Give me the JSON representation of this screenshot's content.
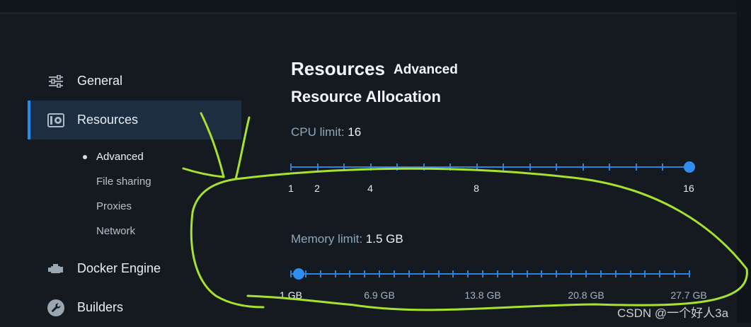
{
  "sidebar": {
    "items": [
      {
        "label": "General",
        "icon": "sliders-icon"
      },
      {
        "label": "Resources",
        "icon": "resources-icon",
        "active": true
      },
      {
        "label": "Docker Engine",
        "icon": "engine-icon"
      },
      {
        "label": "Builders",
        "icon": "wrench-icon"
      }
    ],
    "sub_items": [
      "Advanced",
      "File sharing",
      "Proxies",
      "Network"
    ]
  },
  "main": {
    "title": "Resources",
    "tab": "Advanced",
    "subtitle": "Resource Allocation",
    "cpu": {
      "label": "CPU limit:",
      "value": "16",
      "tick_labels": [
        "1",
        "2",
        "4",
        "8",
        "16"
      ],
      "min": 1,
      "max": 16,
      "current": 16
    },
    "memory": {
      "label": "Memory limit:",
      "value": "1.5 GB",
      "tick_labels": [
        "1 GB",
        "6.9 GB",
        "13.8 GB",
        "20.8 GB",
        "27.7 GB"
      ],
      "min_gb": 1,
      "max_gb": 27.7,
      "current_gb": 1.5
    }
  },
  "watermark": "CSDN @一个好人3a",
  "colors": {
    "accent": "#1f8ef1",
    "annotation": "#a6e22e",
    "background": "#141a1f",
    "sidebar_active": "#1c2e40"
  }
}
